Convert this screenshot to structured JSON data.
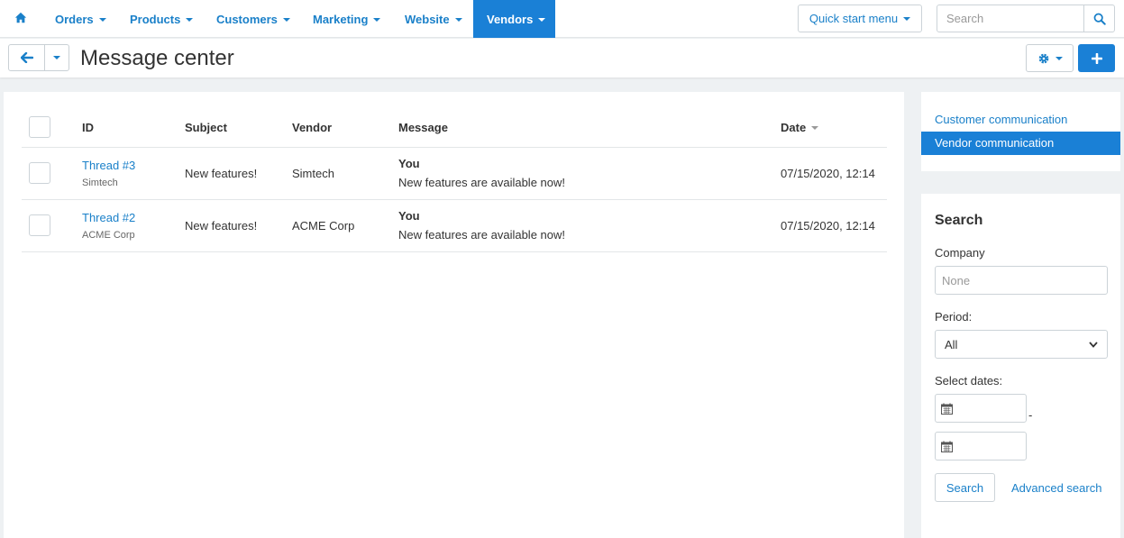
{
  "nav": {
    "items": [
      {
        "label": "Orders"
      },
      {
        "label": "Products"
      },
      {
        "label": "Customers"
      },
      {
        "label": "Marketing"
      },
      {
        "label": "Website"
      },
      {
        "label": "Vendors"
      }
    ],
    "active": "Vendors",
    "quick_start": "Quick start menu",
    "search_placeholder": "Search"
  },
  "header": {
    "title": "Message center"
  },
  "table": {
    "columns": [
      "ID",
      "Subject",
      "Vendor",
      "Message",
      "Date"
    ],
    "sorted_by": "Date",
    "rows": [
      {
        "id": "Thread #3",
        "vendor_sub": "Simtech",
        "subject": "New features!",
        "vendor": "Simtech",
        "author": "You",
        "message": "New features are available now!",
        "date": "07/15/2020, 12:14"
      },
      {
        "id": "Thread #2",
        "vendor_sub": "ACME Corp",
        "subject": "New features!",
        "vendor": "ACME Corp",
        "author": "You",
        "message": "New features are available now!",
        "date": "07/15/2020, 12:14"
      }
    ]
  },
  "sidebar": {
    "links": [
      {
        "label": "Customer communication"
      },
      {
        "label": "Vendor communication"
      }
    ],
    "active": "Vendor communication"
  },
  "search_panel": {
    "title": "Search",
    "company_label": "Company",
    "company_placeholder": "None",
    "period_label": "Period:",
    "period_value": "All",
    "dates_label": "Select dates:",
    "dash": "-",
    "submit": "Search",
    "advanced": "Advanced search"
  },
  "colors": {
    "accent": "#1a80d6",
    "link": "#1a80c9"
  }
}
